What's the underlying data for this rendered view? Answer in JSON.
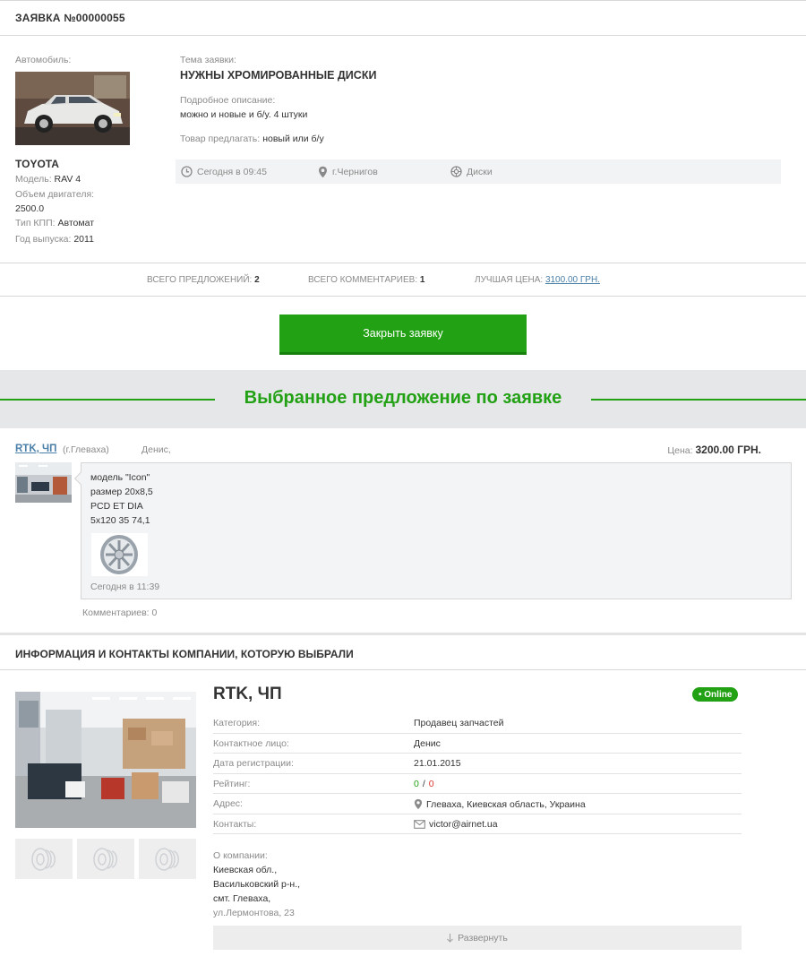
{
  "request": {
    "title": "ЗАЯВКА №00000055",
    "car_label": "Автомобиль:",
    "car_brand": "TOYOTA",
    "model_label": "Модель:",
    "model": "RAV 4",
    "engine_label": "Объем двигателя:",
    "engine": "2500.0",
    "gearbox_label": "Тип КПП:",
    "gearbox": "Автомат",
    "year_label": "Год выпуска:",
    "year": "2011",
    "topic_label": "Тема заявки:",
    "topic": "НУЖНЫ ХРОМИРОВАННЫЕ ДИСКИ",
    "desc_label": "Подробное описание:",
    "desc": "можно и новые и б/у. 4 штуки",
    "offer_label": "Товар предлагать:",
    "offer": "новый или б/у",
    "meta": {
      "time": "Сегодня в 09:45",
      "city": "г.Чернигов",
      "category": "Диски"
    }
  },
  "stats": {
    "offers_label": "ВСЕГО ПРЕДЛОЖЕНИЙ:",
    "offers": "2",
    "comments_label": "ВСЕГО КОММЕНТАРИЕВ:",
    "comments": "1",
    "best_label": "ЛУЧШАЯ ЦЕНА:",
    "best": "3100.00 грн."
  },
  "close_button": "Закрыть заявку",
  "selected": {
    "heading": "Выбранное предложение по заявке",
    "supplier": "RTK, ЧП",
    "city": "(г.Глеваха)",
    "person": "Денис,",
    "price_label": "Цена:",
    "price": "3200.00 ГРН.",
    "lines": [
      "модель \"Icon\"",
      "размер 20х8,5",
      "PCD ET DIA",
      "5х120 35 74,1"
    ],
    "time": "Сегодня в 11:39",
    "comments": "Комментариев: 0"
  },
  "company": {
    "section_title": "ИНФОРМАЦИЯ И КОНТАКТЫ КОМПАНИИ, КОТОРУЮ ВЫБРАЛИ",
    "name": "RTK, ЧП",
    "online": "• Online",
    "rows": {
      "category_k": "Категория:",
      "category_v": "Продавец запчастей",
      "contact_k": "Контактное лицо:",
      "contact_v": "Денис",
      "reg_k": "Дата регистрации:",
      "reg_v": "21.01.2015",
      "rating_k": "Рейтинг:",
      "rating_pos": "0",
      "rating_sep": "/",
      "rating_neg": "0",
      "address_k": "Адрес:",
      "address_v": "Глеваха, Киевская область, Украина",
      "contacts_k": "Контакты:",
      "contacts_v": "victor@airnet.ua"
    },
    "about_label": "О компании:",
    "about_lines": [
      "Киевская обл.,",
      "Васильковский р-н.,",
      "смт. Глеваха,",
      "ул.Лермонтова, 23"
    ],
    "expand": "Развернуть"
  },
  "colors": {
    "accent": "#22a114",
    "link": "#4a7fa8",
    "negative": "#d9342b"
  }
}
